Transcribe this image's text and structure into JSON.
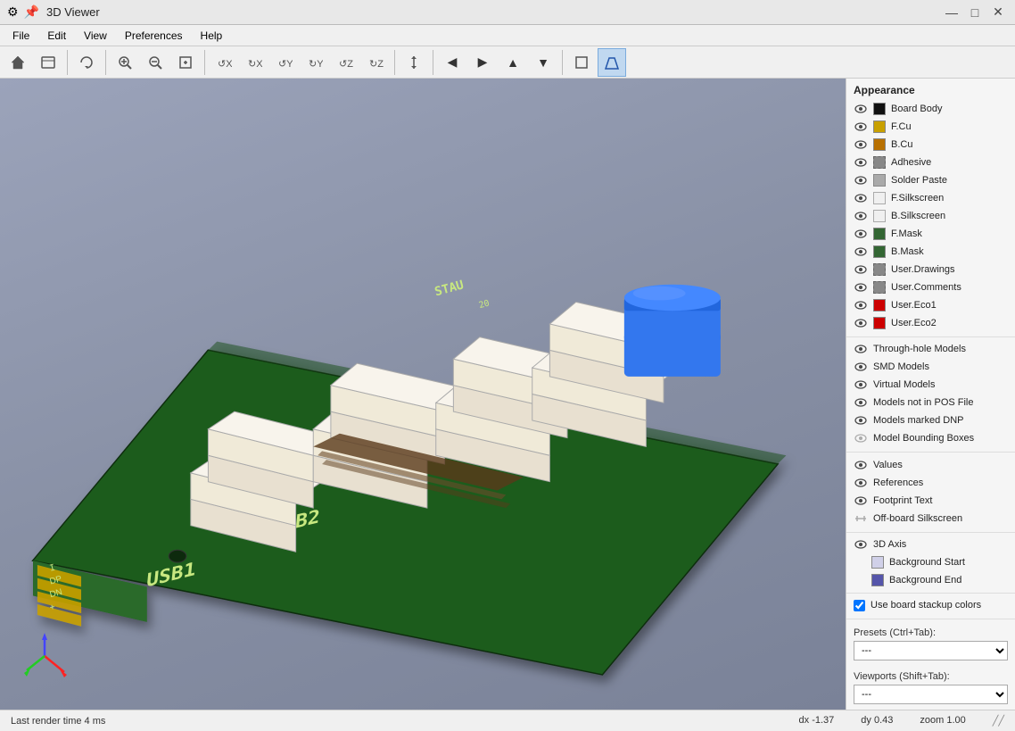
{
  "titlebar": {
    "title": "3D Viewer",
    "minimize": "—",
    "maximize": "□",
    "close": "✕"
  },
  "menubar": {
    "items": [
      "File",
      "Edit",
      "View",
      "Preferences",
      "Help"
    ]
  },
  "toolbar": {
    "buttons": [
      {
        "name": "new",
        "icon": "📄"
      },
      {
        "name": "open",
        "icon": "📁"
      },
      {
        "name": "rotate-3d",
        "icon": "⟳"
      },
      {
        "name": "zoom-in",
        "icon": "+"
      },
      {
        "name": "zoom-out",
        "icon": "−"
      },
      {
        "name": "zoom-fit",
        "icon": "⊡"
      },
      {
        "name": "rotate-x-cw",
        "icon": "↺"
      },
      {
        "name": "rotate-x-ccw",
        "icon": "↻"
      },
      {
        "name": "rotate-y-cw",
        "icon": "↺"
      },
      {
        "name": "rotate-y-ccw",
        "icon": "↻"
      },
      {
        "name": "rotate-z-cw",
        "icon": "↺"
      },
      {
        "name": "rotate-z-ccw",
        "icon": "↻"
      },
      {
        "name": "flip-board",
        "icon": "⇅"
      },
      {
        "name": "pan-left",
        "icon": "←"
      },
      {
        "name": "pan-right",
        "icon": "→"
      },
      {
        "name": "pan-up",
        "icon": "↑"
      },
      {
        "name": "pan-down",
        "icon": "↓"
      },
      {
        "name": "ortho",
        "icon": "⬡"
      },
      {
        "name": "perspective",
        "icon": "◈"
      }
    ]
  },
  "appearance": {
    "title": "Appearance",
    "layers": [
      {
        "label": "Board Body",
        "color": "#111111",
        "visible": true
      },
      {
        "label": "F.Cu",
        "color": "#c8a000",
        "visible": true
      },
      {
        "label": "B.Cu",
        "color": "#b87000",
        "visible": true
      },
      {
        "label": "Adhesive",
        "color": "#888888",
        "visible": true,
        "no_color": true
      },
      {
        "label": "Solder Paste",
        "color": "#888888",
        "visible": true
      },
      {
        "label": "F.Silkscreen",
        "color": "#eeeeee",
        "visible": true
      },
      {
        "label": "B.Silkscreen",
        "color": "#eeeeee",
        "visible": true
      },
      {
        "label": "F.Mask",
        "color": "#336633",
        "visible": true
      },
      {
        "label": "B.Mask",
        "color": "#336633",
        "visible": true
      },
      {
        "label": "User.Drawings",
        "color": "#888888",
        "visible": true,
        "no_color": true
      },
      {
        "label": "User.Comments",
        "color": "#888888",
        "visible": true,
        "no_color": true
      },
      {
        "label": "User.Eco1",
        "color": "#cc0000",
        "visible": true
      },
      {
        "label": "User.Eco2",
        "color": "#cc0000",
        "visible": true
      }
    ],
    "models": [
      {
        "label": "Through-hole Models",
        "visible": true
      },
      {
        "label": "SMD Models",
        "visible": true
      },
      {
        "label": "Virtual Models",
        "visible": true
      },
      {
        "label": "Models not in POS File",
        "visible": true
      },
      {
        "label": "Models marked DNP",
        "visible": true
      },
      {
        "label": "Model Bounding Boxes",
        "visible": false
      }
    ],
    "text_layers": [
      {
        "label": "Values",
        "visible": true
      },
      {
        "label": "References",
        "visible": true
      },
      {
        "label": "Footprint Text",
        "visible": true
      },
      {
        "label": "Off-board Silkscreen",
        "visible": false
      }
    ],
    "extras": [
      {
        "label": "3D Axis",
        "visible": true
      },
      {
        "label": "Background Start",
        "color_class": "bg-start"
      },
      {
        "label": "Background End",
        "color_class": "bg-end"
      }
    ],
    "use_board_stackup": true,
    "use_board_stackup_label": "Use board stackup colors",
    "presets_label": "Presets (Ctrl+Tab):",
    "presets_value": "---",
    "viewports_label": "Viewports (Shift+Tab):",
    "viewports_value": "---"
  },
  "statusbar": {
    "render_time": "Last render time 4 ms",
    "dx": "dx -1.37",
    "dy": "dy 0.43",
    "zoom": "zoom 1.00"
  }
}
